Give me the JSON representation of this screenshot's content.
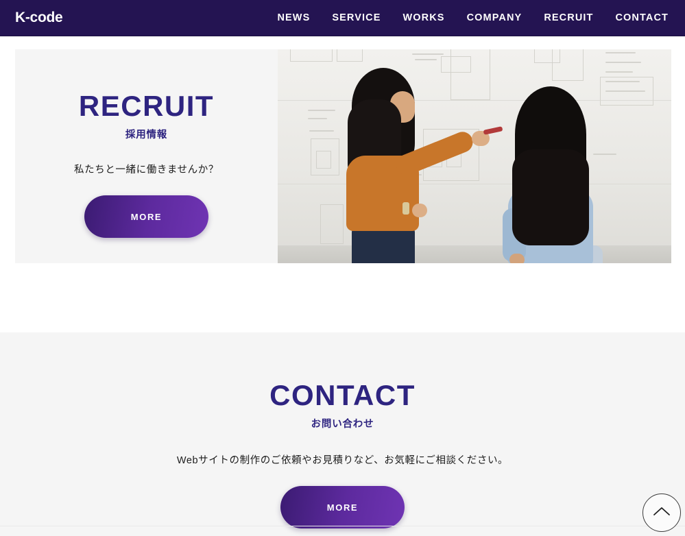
{
  "header": {
    "logo": "K-code",
    "nav": [
      {
        "label": "NEWS"
      },
      {
        "label": "SERVICE"
      },
      {
        "label": "WORKS"
      },
      {
        "label": "COMPANY"
      },
      {
        "label": "RECRUIT"
      },
      {
        "label": "CONTACT"
      }
    ],
    "background_color": "#241452"
  },
  "recruit": {
    "title": "RECRUIT",
    "subtitle": "採用情報",
    "lead": "私たちと一緒に働きませんか？",
    "more_label": "MORE",
    "image_alt": "ホワイトボードの前で打ち合わせをする2人の女性",
    "card_background": "#f5f5f5",
    "heading_color": "#2e2480"
  },
  "contact": {
    "title": "CONTACT",
    "subtitle": "お問い合わせ",
    "lead": "Webサイトの制作のご依頼やお見積りなど、お気軽にご相談ください。",
    "more_label": "MORE",
    "section_background": "#f5f5f5",
    "heading_color": "#2e2480"
  },
  "scroll_top": {
    "icon": "chevron-up-icon",
    "label": "ページ上部へ戻る"
  },
  "theme": {
    "button_gradient_start": "#3b1b72",
    "button_gradient_end": "#6f34b3",
    "accent": "#2e2480"
  }
}
